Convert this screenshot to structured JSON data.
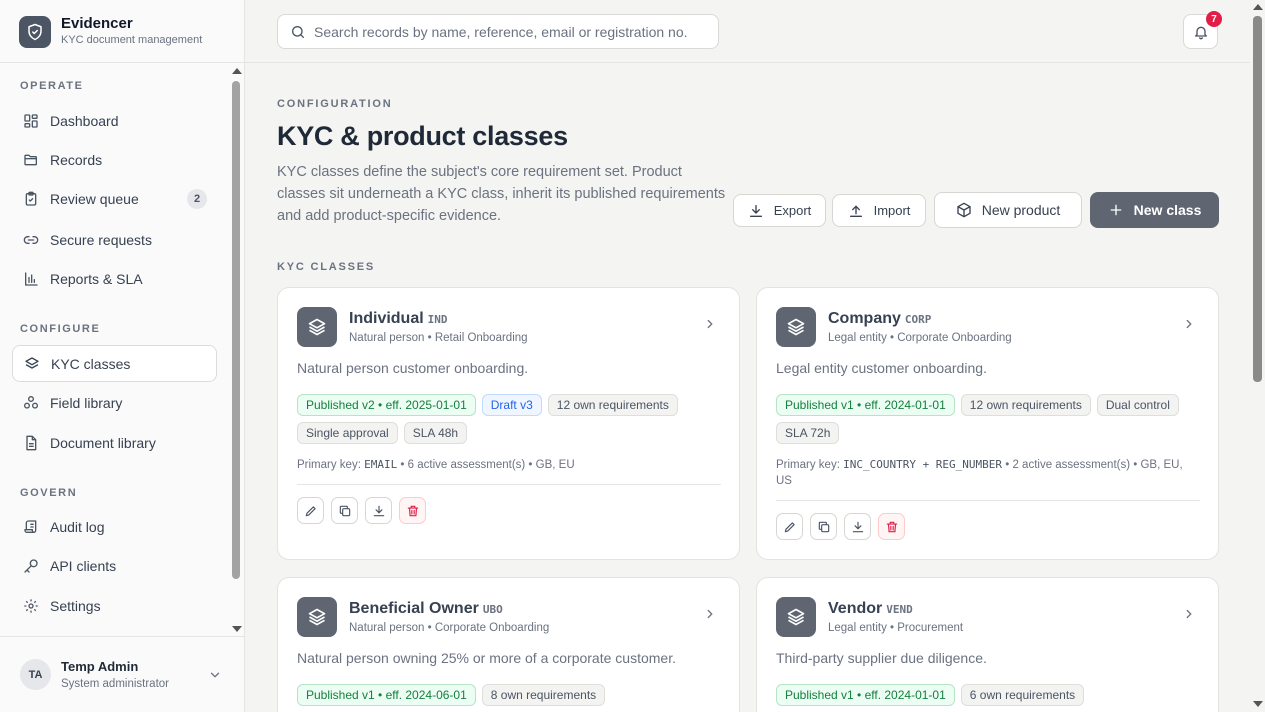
{
  "brand": {
    "name": "Evidencer",
    "subtitle": "KYC document management"
  },
  "nav": {
    "sections": [
      {
        "label": "OPERATE"
      },
      {
        "label": "CONFIGURE"
      },
      {
        "label": "GOVERN"
      }
    ],
    "items": [
      {
        "label": "Dashboard",
        "icon": "dashboard-icon"
      },
      {
        "label": "Records",
        "icon": "folder-icon"
      },
      {
        "label": "Review queue",
        "icon": "clipboard-icon",
        "badge": "2"
      },
      {
        "label": "Secure requests",
        "icon": "link-icon"
      },
      {
        "label": "Reports & SLA",
        "icon": "bar-chart-icon"
      },
      {
        "label": "KYC classes",
        "icon": "layers-icon",
        "active": true
      },
      {
        "label": "Field library",
        "icon": "shapes-icon"
      },
      {
        "label": "Document library",
        "icon": "document-icon"
      },
      {
        "label": "Audit log",
        "icon": "scroll-icon"
      },
      {
        "label": "API clients",
        "icon": "key-icon"
      },
      {
        "label": "Settings",
        "icon": "gear-icon"
      }
    ]
  },
  "user": {
    "initials": "TA",
    "name": "Temp Admin",
    "role": "System administrator"
  },
  "search": {
    "placeholder": "Search records by name, reference, email or registration no."
  },
  "notifications": {
    "count": "7"
  },
  "header": {
    "eyebrow": "CONFIGURATION",
    "title": "KYC & product classes",
    "description": "KYC classes define the subject's core requirement set. Product classes sit underneath a KYC class, inherit its published requirements and add product-specific evidence."
  },
  "toolbar": {
    "export": "Export",
    "import": "Import",
    "new_product": "New product",
    "new_class": "New class"
  },
  "section_label": "KYC CLASSES",
  "classes": [
    {
      "name": "Individual",
      "code": "IND",
      "subtitle": "Natural person • Retail Onboarding",
      "description": "Natural person customer onboarding.",
      "tags": [
        {
          "text": "Published v2 • eff. 2025-01-01",
          "tone": "green"
        },
        {
          "text": "Draft v3",
          "tone": "blue"
        },
        {
          "text": "12 own requirements",
          "tone": "gray"
        },
        {
          "text": "Single approval",
          "tone": "gray"
        },
        {
          "text": "SLA 48h",
          "tone": "gray"
        }
      ],
      "meta_prefix": "Primary key: ",
      "primary_key": "EMAIL",
      "meta_suffix": " • 6 active assessment(s) • GB, EU"
    },
    {
      "name": "Company",
      "code": "CORP",
      "subtitle": "Legal entity • Corporate Onboarding",
      "description": "Legal entity customer onboarding.",
      "tags": [
        {
          "text": "Published v1 • eff. 2024-01-01",
          "tone": "green"
        },
        {
          "text": "12 own requirements",
          "tone": "gray"
        },
        {
          "text": "Dual control",
          "tone": "gray"
        },
        {
          "text": "SLA 72h",
          "tone": "gray"
        }
      ],
      "meta_prefix": "Primary key: ",
      "primary_key": "INC_COUNTRY + REG_NUMBER",
      "meta_suffix": " • 2 active assessment(s) • GB, EU, US"
    },
    {
      "name": "Beneficial Owner",
      "code": "UBO",
      "subtitle": "Natural person • Corporate Onboarding",
      "description": "Natural person owning 25% or more of a corporate customer.",
      "tags": [
        {
          "text": "Published v1 • eff. 2024-06-01",
          "tone": "green"
        },
        {
          "text": "8 own requirements",
          "tone": "gray"
        }
      ]
    },
    {
      "name": "Vendor",
      "code": "VEND",
      "subtitle": "Legal entity • Procurement",
      "description": "Third-party supplier due diligence.",
      "tags": [
        {
          "text": "Published v1 • eff. 2024-01-01",
          "tone": "green"
        },
        {
          "text": "6 own requirements",
          "tone": "gray"
        }
      ]
    }
  ]
}
